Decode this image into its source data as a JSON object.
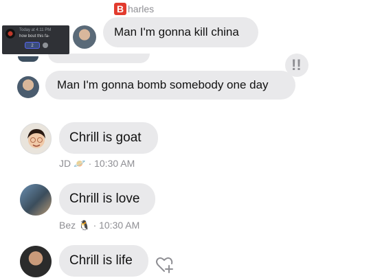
{
  "header": {
    "badge": "B",
    "name_rest": "harles"
  },
  "messages": [
    {
      "text": "Man I'm gonna kill china"
    },
    {
      "text": "Man I'm gonna bomb somebody one day"
    },
    {
      "text": "Chrill is goat",
      "sender": "JD",
      "time": "· 10:30 AM"
    },
    {
      "text": "Chrill is love",
      "sender": "Bez",
      "time": "· 10:30 AM"
    },
    {
      "text": "Chrill is life"
    }
  ],
  "embed": {
    "meta": "Today at 4:11 PM",
    "text": "how bout this fa-",
    "reaction_count": "2"
  },
  "tapback": "!!",
  "icons": {
    "saturn": "planet-icon",
    "penguin": "penguin-icon",
    "heart_add": "heart-add-icon"
  }
}
